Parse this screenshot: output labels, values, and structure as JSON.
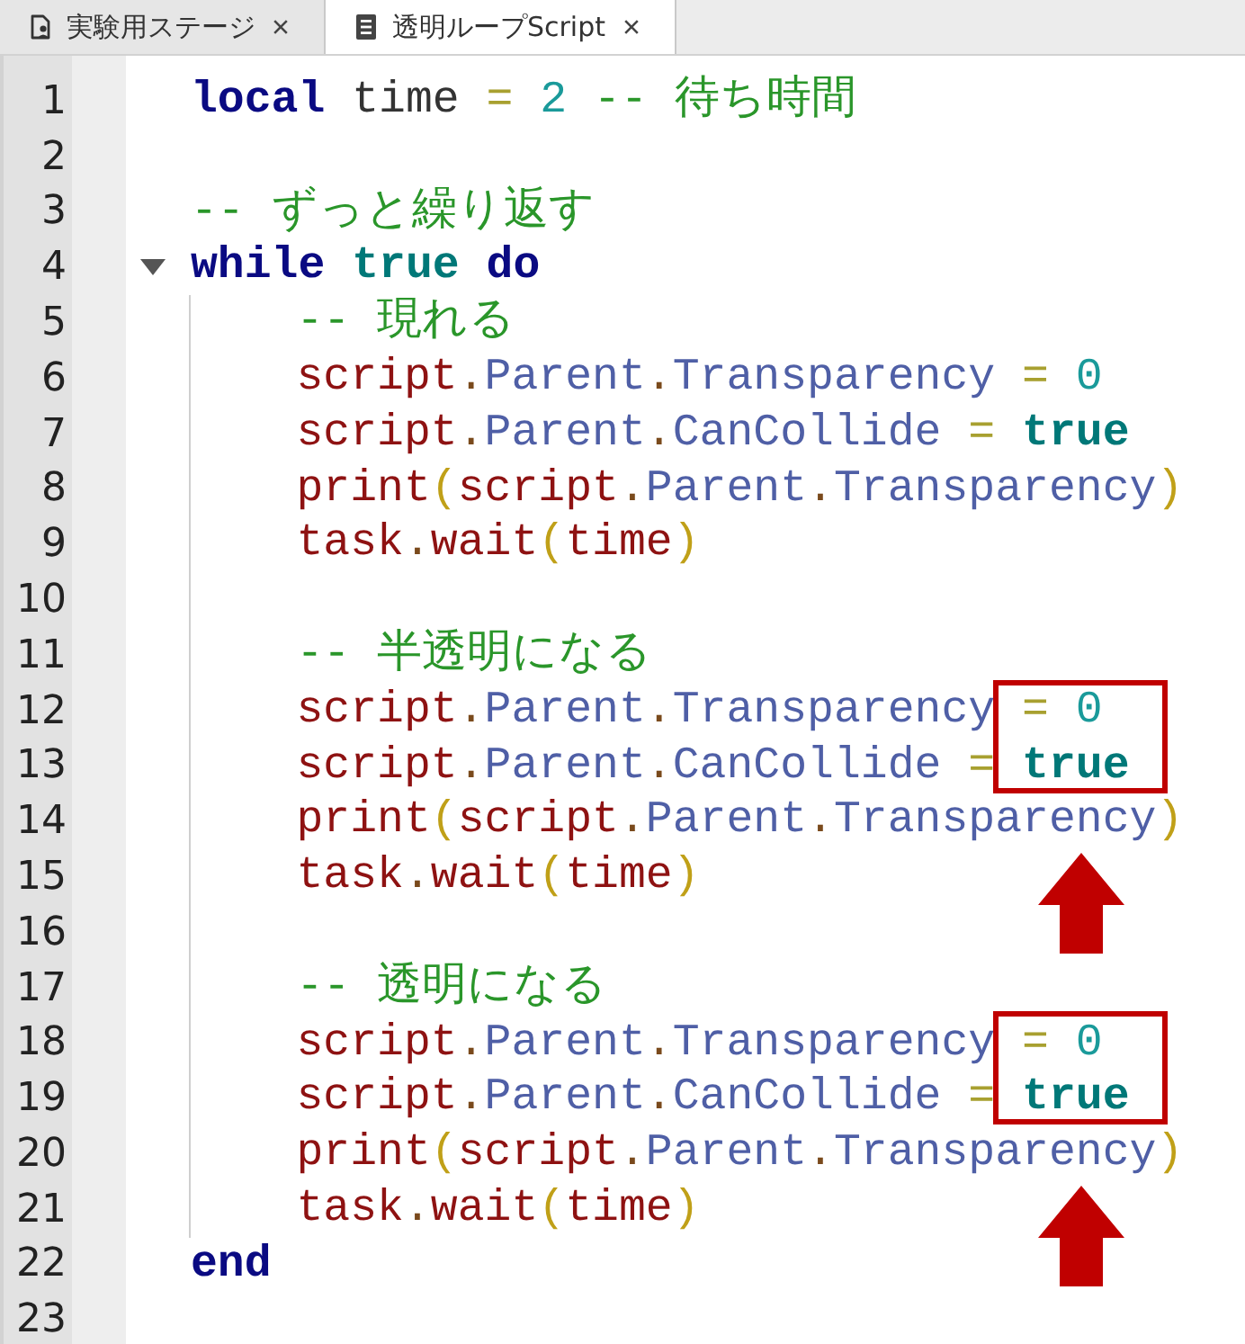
{
  "tabs": [
    {
      "label": "実験用ステージ",
      "kind": "place",
      "selected": false
    },
    {
      "label": "透明ループScript",
      "kind": "script",
      "selected": true
    }
  ],
  "editor": {
    "lines": [
      {
        "number": "1",
        "callout": false,
        "tokens": [
          {
            "kind": "keyword",
            "text": "local"
          },
          {
            "kind": "name",
            "text": " time"
          },
          {
            "kind": "operator",
            "text": " ="
          },
          {
            "kind": "number",
            "text": " 2"
          },
          {
            "kind": "comment",
            "text": " -- 待ち時間"
          }
        ]
      },
      {
        "number": "2",
        "callout": false
      },
      {
        "number": "3",
        "callout": false,
        "tokens": [
          {
            "kind": "comment",
            "text": "-- ずっと繰り返す"
          }
        ]
      },
      {
        "number": "4",
        "callout": false,
        "expanded": true,
        "tokens": [
          {
            "kind": "keyword",
            "text": "while"
          },
          {
            "kind": "constant",
            "text": " true"
          },
          {
            "kind": "keyword",
            "text": " do"
          }
        ],
        "children": [
          {
            "number": "5",
            "callout": false,
            "tokens": [
              {
                "kind": "comment",
                "text": "-- 現れる"
              }
            ]
          },
          {
            "number": "6",
            "callout": false,
            "tokens": [
              {
                "kind": "builtin",
                "text": "script"
              },
              {
                "kind": "dot",
                "text": "."
              },
              {
                "kind": "property",
                "text": "Parent"
              },
              {
                "kind": "dot",
                "text": "."
              },
              {
                "kind": "property",
                "text": "Transparency"
              },
              {
                "kind": "operator",
                "text": " ="
              },
              {
                "kind": "number",
                "text": " 0"
              }
            ]
          },
          {
            "number": "7",
            "callout": false,
            "tokens": [
              {
                "kind": "builtin",
                "text": "script"
              },
              {
                "kind": "dot",
                "text": "."
              },
              {
                "kind": "property",
                "text": "Parent"
              },
              {
                "kind": "dot",
                "text": "."
              },
              {
                "kind": "property",
                "text": "CanCollide"
              },
              {
                "kind": "operator",
                "text": " ="
              },
              {
                "kind": "constant",
                "text": " true"
              }
            ]
          },
          {
            "number": "8",
            "callout": false,
            "tokens": [
              {
                "kind": "builtin",
                "text": "print"
              },
              {
                "kind": "paren",
                "text": "("
              },
              {
                "kind": "builtin",
                "text": "script"
              },
              {
                "kind": "dot",
                "text": "."
              },
              {
                "kind": "property",
                "text": "Parent"
              },
              {
                "kind": "dot",
                "text": "."
              },
              {
                "kind": "property",
                "text": "Transparency"
              },
              {
                "kind": "paren",
                "text": ")"
              }
            ]
          },
          {
            "number": "9",
            "callout": false,
            "tokens": [
              {
                "kind": "builtin",
                "text": "task"
              },
              {
                "kind": "dot",
                "text": "."
              },
              {
                "kind": "builtin",
                "text": "wait"
              },
              {
                "kind": "paren",
                "text": "("
              },
              {
                "kind": "builtin",
                "text": "time"
              },
              {
                "kind": "paren",
                "text": ")"
              }
            ]
          },
          {
            "number": "10",
            "callout": false
          },
          {
            "number": "11",
            "callout": false,
            "tokens": [
              {
                "kind": "comment",
                "text": "-- 半透明になる"
              }
            ]
          },
          {
            "number": "12",
            "callout": true,
            "tokens": [
              {
                "kind": "builtin",
                "text": "script"
              },
              {
                "kind": "dot",
                "text": "."
              },
              {
                "kind": "property",
                "text": "Parent"
              },
              {
                "kind": "dot",
                "text": "."
              },
              {
                "kind": "property",
                "text": "Transparency"
              },
              {
                "kind": "operator",
                "text": " ="
              },
              {
                "kind": "number",
                "text": " 0"
              }
            ]
          },
          {
            "number": "13",
            "callout": false,
            "tokens": [
              {
                "kind": "builtin",
                "text": "script"
              },
              {
                "kind": "dot",
                "text": "."
              },
              {
                "kind": "property",
                "text": "Parent"
              },
              {
                "kind": "dot",
                "text": "."
              },
              {
                "kind": "property",
                "text": "CanCollide"
              },
              {
                "kind": "operator",
                "text": " ="
              },
              {
                "kind": "constant",
                "text": " true"
              }
            ]
          },
          {
            "number": "14",
            "callout": false,
            "tokens": [
              {
                "kind": "builtin",
                "text": "print"
              },
              {
                "kind": "paren",
                "text": "("
              },
              {
                "kind": "builtin",
                "text": "script"
              },
              {
                "kind": "dot",
                "text": "."
              },
              {
                "kind": "property",
                "text": "Parent"
              },
              {
                "kind": "dot",
                "text": "."
              },
              {
                "kind": "property",
                "text": "Transparency"
              },
              {
                "kind": "paren",
                "text": ")"
              }
            ]
          },
          {
            "number": "15",
            "callout": false,
            "tokens": [
              {
                "kind": "builtin",
                "text": "task"
              },
              {
                "kind": "dot",
                "text": "."
              },
              {
                "kind": "builtin",
                "text": "wait"
              },
              {
                "kind": "paren",
                "text": "("
              },
              {
                "kind": "builtin",
                "text": "time"
              },
              {
                "kind": "paren",
                "text": ")"
              }
            ]
          },
          {
            "number": "16",
            "callout": false
          },
          {
            "number": "17",
            "callout": false,
            "tokens": [
              {
                "kind": "comment",
                "text": "-- 透明になる"
              }
            ]
          },
          {
            "number": "18",
            "callout": true,
            "tokens": [
              {
                "kind": "builtin",
                "text": "script"
              },
              {
                "kind": "dot",
                "text": "."
              },
              {
                "kind": "property",
                "text": "Parent"
              },
              {
                "kind": "dot",
                "text": "."
              },
              {
                "kind": "property",
                "text": "Transparency"
              },
              {
                "kind": "operator",
                "text": " ="
              },
              {
                "kind": "number",
                "text": " 0"
              }
            ]
          },
          {
            "number": "19",
            "callout": false,
            "tokens": [
              {
                "kind": "builtin",
                "text": "script"
              },
              {
                "kind": "dot",
                "text": "."
              },
              {
                "kind": "property",
                "text": "Parent"
              },
              {
                "kind": "dot",
                "text": "."
              },
              {
                "kind": "property",
                "text": "CanCollide"
              },
              {
                "kind": "operator",
                "text": " ="
              },
              {
                "kind": "constant",
                "text": " true"
              }
            ]
          },
          {
            "number": "20",
            "callout": false,
            "tokens": [
              {
                "kind": "builtin",
                "text": "print"
              },
              {
                "kind": "paren",
                "text": "("
              },
              {
                "kind": "builtin",
                "text": "script"
              },
              {
                "kind": "dot",
                "text": "."
              },
              {
                "kind": "property",
                "text": "Parent"
              },
              {
                "kind": "dot",
                "text": "."
              },
              {
                "kind": "property",
                "text": "Transparency"
              },
              {
                "kind": "paren",
                "text": ")"
              }
            ]
          },
          {
            "number": "21",
            "callout": false,
            "tokens": [
              {
                "kind": "builtin",
                "text": "task"
              },
              {
                "kind": "dot",
                "text": "."
              },
              {
                "kind": "builtin",
                "text": "wait"
              },
              {
                "kind": "paren",
                "text": "("
              },
              {
                "kind": "builtin",
                "text": "time"
              },
              {
                "kind": "paren",
                "text": ")"
              }
            ]
          }
        ]
      },
      {
        "number": "22",
        "callout": false,
        "tokens": [
          {
            "kind": "keyword",
            "text": "end"
          }
        ]
      },
      {
        "number": "23",
        "callout": false
      }
    ]
  }
}
